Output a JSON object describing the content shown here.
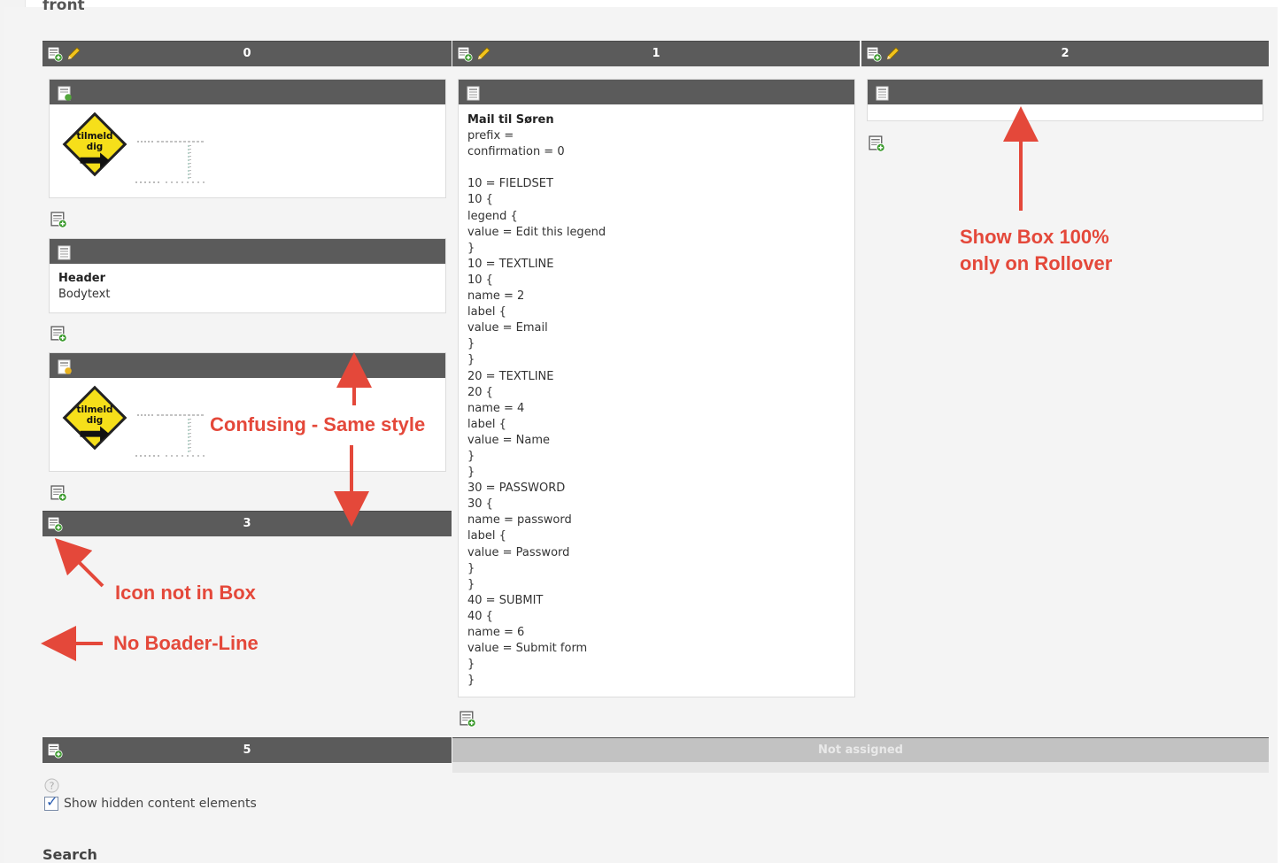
{
  "page": {
    "title": "front"
  },
  "columns": [
    {
      "label": "0"
    },
    {
      "label": "1"
    },
    {
      "label": "2"
    },
    {
      "label": "3"
    },
    {
      "label": "5"
    },
    {
      "label": "Not assigned"
    }
  ],
  "elements": {
    "text_element": {
      "header": "Header",
      "body": "Bodytext"
    },
    "mail_form": {
      "header": "Mail til Søren",
      "lines": [
        "prefix =",
        "confirmation = 0",
        "",
        "10 = FIELDSET",
        "10 {",
        "legend {",
        "value = Edit this legend",
        "}",
        "10 = TEXTLINE",
        "10 {",
        "name = 2",
        "label {",
        "value = Email",
        "}",
        "}",
        "20 = TEXTLINE",
        "20 {",
        "name = 4",
        "label {",
        "value = Name",
        "}",
        "}",
        "30 = PASSWORD",
        "30 {",
        "name = password",
        "label {",
        "value = Password",
        "}",
        "}",
        "40 = SUBMIT",
        "40 {",
        "name = 6",
        "value = Submit form",
        "}",
        "}"
      ]
    },
    "image_logo_text": "tilmeld dig"
  },
  "annotations": {
    "confusing": "Confusing - Same style",
    "icon_not_in_box": "Icon not in Box",
    "no_border": "No Boader-Line",
    "show_box_line1": "Show Box 100%",
    "show_box_line2": "only on Rollover"
  },
  "options": {
    "show_hidden_label": "Show hidden content elements",
    "show_hidden_checked": true
  },
  "search": {
    "heading": "Search"
  },
  "colors": {
    "header_bar": "#5b5b5b",
    "annotation": "#e4483a",
    "unassigned_bar": "#c2c2c2"
  }
}
